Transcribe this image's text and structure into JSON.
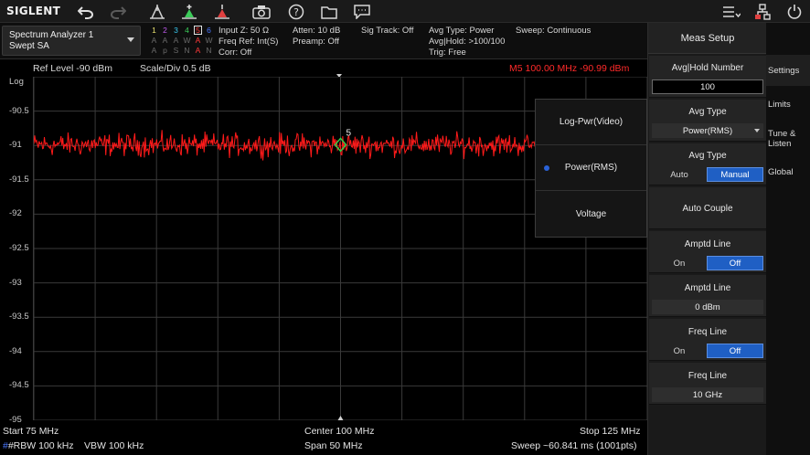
{
  "brand": "SIGLENT",
  "toolbar": {
    "icons": [
      "undo-icon",
      "redo-icon",
      "peak-icon",
      "marker-add-icon",
      "marker-icon",
      "camera-icon",
      "help-icon",
      "folder-icon",
      "message-icon",
      "menu-list-icon",
      "network-icon",
      "power-icon"
    ]
  },
  "status": {
    "mode_line1": "Spectrum Analyzer 1",
    "mode_line2": "Swept SA",
    "traces": {
      "numbers": [
        "1",
        "2",
        "3",
        "4",
        "5",
        "6"
      ],
      "row2": [
        "A",
        "A",
        "A",
        "W",
        "A",
        "W"
      ],
      "row3": [
        "A",
        "p",
        "S",
        "N",
        "A",
        "N"
      ]
    },
    "input_z": "Input Z: 50 Ω",
    "freq_ref": "Freq Ref: Int(S)",
    "corr": "Corr: Off",
    "atten": "Atten: 10 dB",
    "preamp": "Preamp: Off",
    "sig_track": "Sig Track: Off",
    "avg_type": "Avg Type: Power",
    "avg_hold": "Avg|Hold: >100/100",
    "trig": "Trig: Free",
    "sweep": "Sweep: Continuous"
  },
  "graph": {
    "ref_level": "Ref Level  -90 dBm",
    "scale_div": "Scale/Div  0.5 dB",
    "marker_readout": "M5   100.00 MHz  -90.99 dBm",
    "y_scale_label": "Log",
    "y_ticks": [
      "-90.5",
      "-91",
      "-91.5",
      "-92",
      "-92.5",
      "-93",
      "-93.5",
      "-94",
      "-94.5",
      "-95"
    ],
    "marker_label": "5",
    "trace_color": "#ff1a1a",
    "marker_color": "#2fd44a"
  },
  "chart_data": {
    "type": "line",
    "title": "",
    "xlabel": "",
    "ylabel": "Log",
    "xlim": [
      75,
      125
    ],
    "ylim": [
      -95,
      -90
    ],
    "x_unit": "MHz",
    "y_unit": "dBm",
    "series": [
      {
        "name": "",
        "mean": -90.99,
        "spread": 0.15,
        "points": 1001
      }
    ],
    "markers": [
      {
        "label": "5",
        "x": 100.0,
        "y": -90.99
      }
    ],
    "grid": true
  },
  "footer": {
    "start": "Start  75 MHz",
    "center": "Center  100 MHz",
    "stop": "Stop  125 MHz",
    "rbw": "#RBW  100 kHz",
    "vbw": "VBW  100 kHz",
    "span": "Span  50 MHz",
    "sweep_time": "Sweep  ~60.841 ms (1001pts)"
  },
  "popup": {
    "items": [
      "Log-Pwr(Video)",
      "Power(RMS)",
      "Voltage"
    ],
    "selected_index": 1
  },
  "panel": {
    "title": "Meas Setup",
    "avg_hold_label": "Avg|Hold Number",
    "avg_hold_value": "100",
    "avg_type_label": "Avg Type",
    "avg_type_value": "Power(RMS)",
    "avg_type2_label": "Avg Type",
    "avg_type2_options": [
      "Auto",
      "Manual"
    ],
    "avg_type2_selected": "Manual",
    "auto_couple": "Auto Couple",
    "amptd_line_label": "Amptd Line",
    "amptd_line_options": [
      "On",
      "Off"
    ],
    "amptd_line_selected": "Off",
    "amptd_line2_label": "Amptd Line",
    "amptd_line2_value": "0 dBm",
    "freq_line_label": "Freq Line",
    "freq_line_options": [
      "On",
      "Off"
    ],
    "freq_line_selected": "Off",
    "freq_line2_label": "Freq Line",
    "freq_line2_value": "10 GHz"
  },
  "sidetabs": {
    "settings": "Settings",
    "limits": "Limits",
    "tune_line1": "Tune &",
    "tune_line2": "Listen",
    "global": "Global"
  },
  "colors": {
    "accent_blue": "#1f5fc4",
    "marker_red": "#ff2a2a",
    "trace_numbers": [
      "#e8e070",
      "#c25cf0",
      "#38c8ef",
      "#3ccb5a",
      "#ff3a3a",
      "#4a78ff"
    ]
  }
}
